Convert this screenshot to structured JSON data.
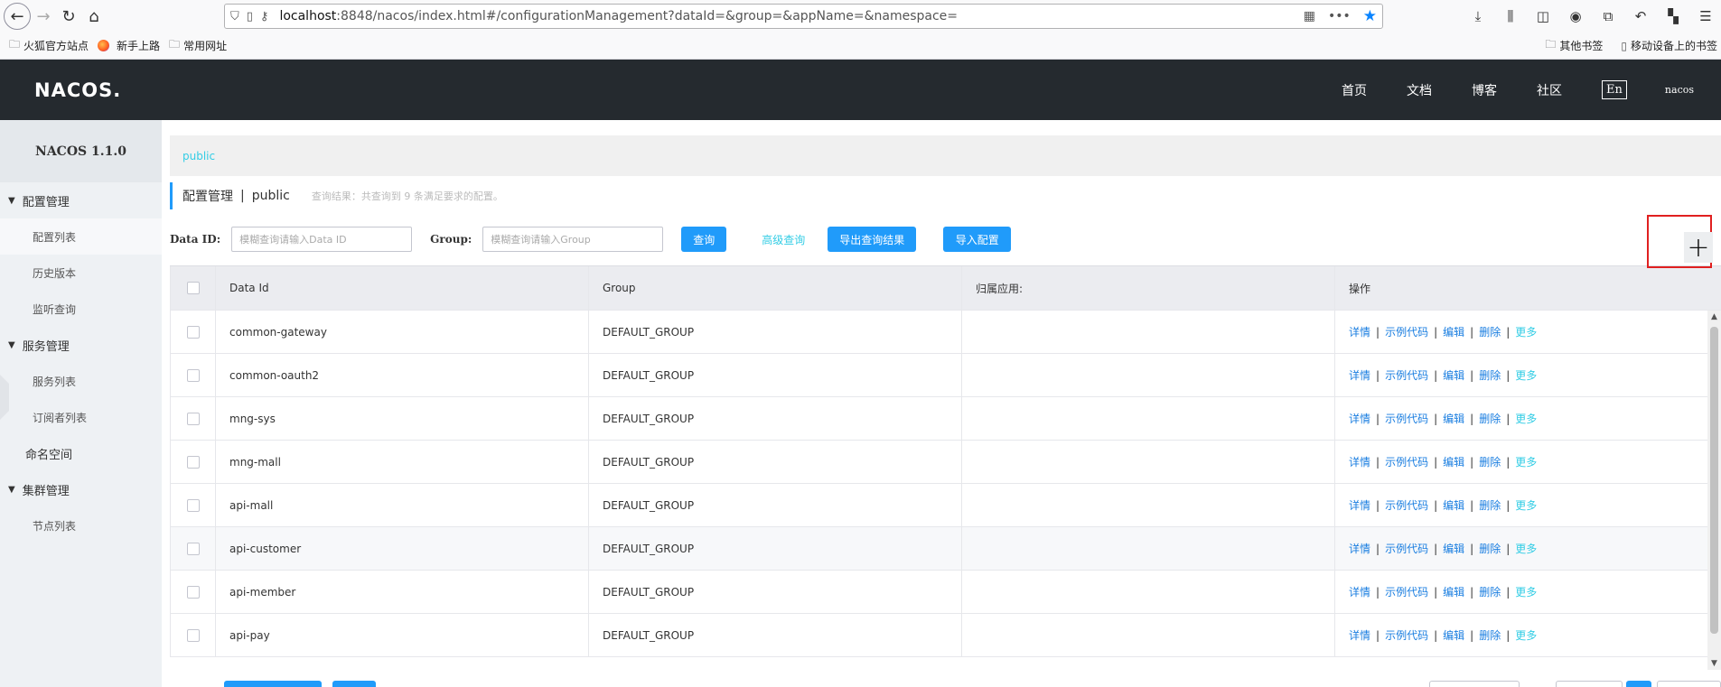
{
  "browser": {
    "url_host": "localhost",
    "url_rest": ":8848/nacos/index.html#/configurationManagement?dataId=&group=&appName=&namespace=",
    "bookmarks": [
      "火狐官方站点",
      "新手上路",
      "常用网址"
    ],
    "bookmarks_right": [
      "其他书签",
      "移动设备上的书签"
    ]
  },
  "header": {
    "logo": "NACOS.",
    "nav": [
      "首页",
      "文档",
      "博客",
      "社区"
    ],
    "lang": "En",
    "user": "nacos"
  },
  "sidebar": {
    "title": "NACOS 1.1.0",
    "config_group": "配置管理",
    "config_items": [
      "配置列表",
      "历史版本",
      "监听查询"
    ],
    "service_group": "服务管理",
    "service_items": [
      "服务列表",
      "订阅者列表"
    ],
    "namespace": "命名空间",
    "cluster_group": "集群管理",
    "cluster_items": [
      "节点列表"
    ]
  },
  "main": {
    "namespace_tab": "public",
    "title": "配置管理",
    "title_sep": "|",
    "title_ns": "public",
    "result_hint": "查询结果：共查询到 9 条满足要求的配置。",
    "search": {
      "dataid_label": "Data ID:",
      "dataid_placeholder": "模糊查询请输入Data ID",
      "group_label": "Group:",
      "group_placeholder": "模糊查询请输入Group",
      "query_btn": "查询",
      "advanced_link": "高级查询",
      "export_btn": "导出查询结果",
      "import_btn": "导入配置"
    },
    "add_icon": "+",
    "table": {
      "headers": [
        "Data Id",
        "Group",
        "归属应用:",
        "操作"
      ],
      "ops": [
        "详情",
        "示例代码",
        "编辑",
        "删除",
        "更多"
      ],
      "rows": [
        {
          "id": "common-gateway",
          "group": "DEFAULT_GROUP"
        },
        {
          "id": "common-oauth2",
          "group": "DEFAULT_GROUP"
        },
        {
          "id": "mng-sys",
          "group": "DEFAULT_GROUP"
        },
        {
          "id": "mng-mall",
          "group": "DEFAULT_GROUP"
        },
        {
          "id": "api-mall",
          "group": "DEFAULT_GROUP"
        },
        {
          "id": "api-customer",
          "group": "DEFAULT_GROUP"
        },
        {
          "id": "api-member",
          "group": "DEFAULT_GROUP"
        },
        {
          "id": "api-pay",
          "group": "DEFAULT_GROUP"
        }
      ]
    }
  }
}
